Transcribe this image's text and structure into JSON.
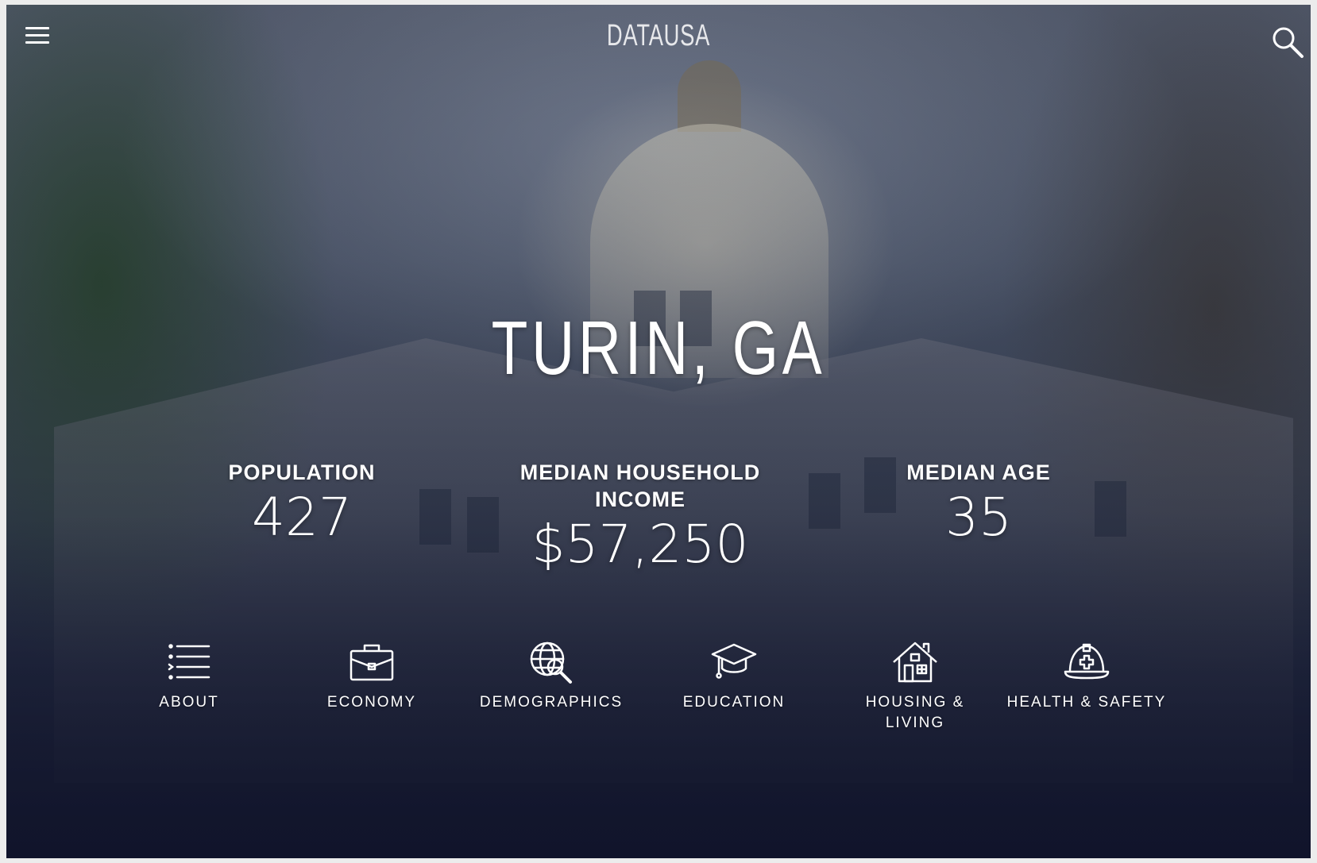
{
  "header": {
    "logo_text": "DATAUSA",
    "menu_icon": "hamburger-menu-icon",
    "search_icon": "search-icon"
  },
  "hero": {
    "title": "TURIN, GA",
    "background": "state-capitol-building-photo"
  },
  "stats": [
    {
      "label": "POPULATION",
      "value": "427"
    },
    {
      "label": "MEDIAN HOUSEHOLD INCOME",
      "value": "$57,250"
    },
    {
      "label": "MEDIAN AGE",
      "value": "35"
    }
  ],
  "nav": [
    {
      "label": "ABOUT",
      "icon": "list-icon"
    },
    {
      "label": "ECONOMY",
      "icon": "briefcase-icon"
    },
    {
      "label": "DEMOGRAPHICS",
      "icon": "globe-magnifier-icon"
    },
    {
      "label": "EDUCATION",
      "icon": "graduation-cap-icon"
    },
    {
      "label": "HOUSING & LIVING",
      "icon": "house-icon"
    },
    {
      "label": "HEALTH & SAFETY",
      "icon": "hard-hat-icon"
    }
  ],
  "colors": {
    "text": "#ffffff",
    "overlay_dark": "#151a33"
  }
}
